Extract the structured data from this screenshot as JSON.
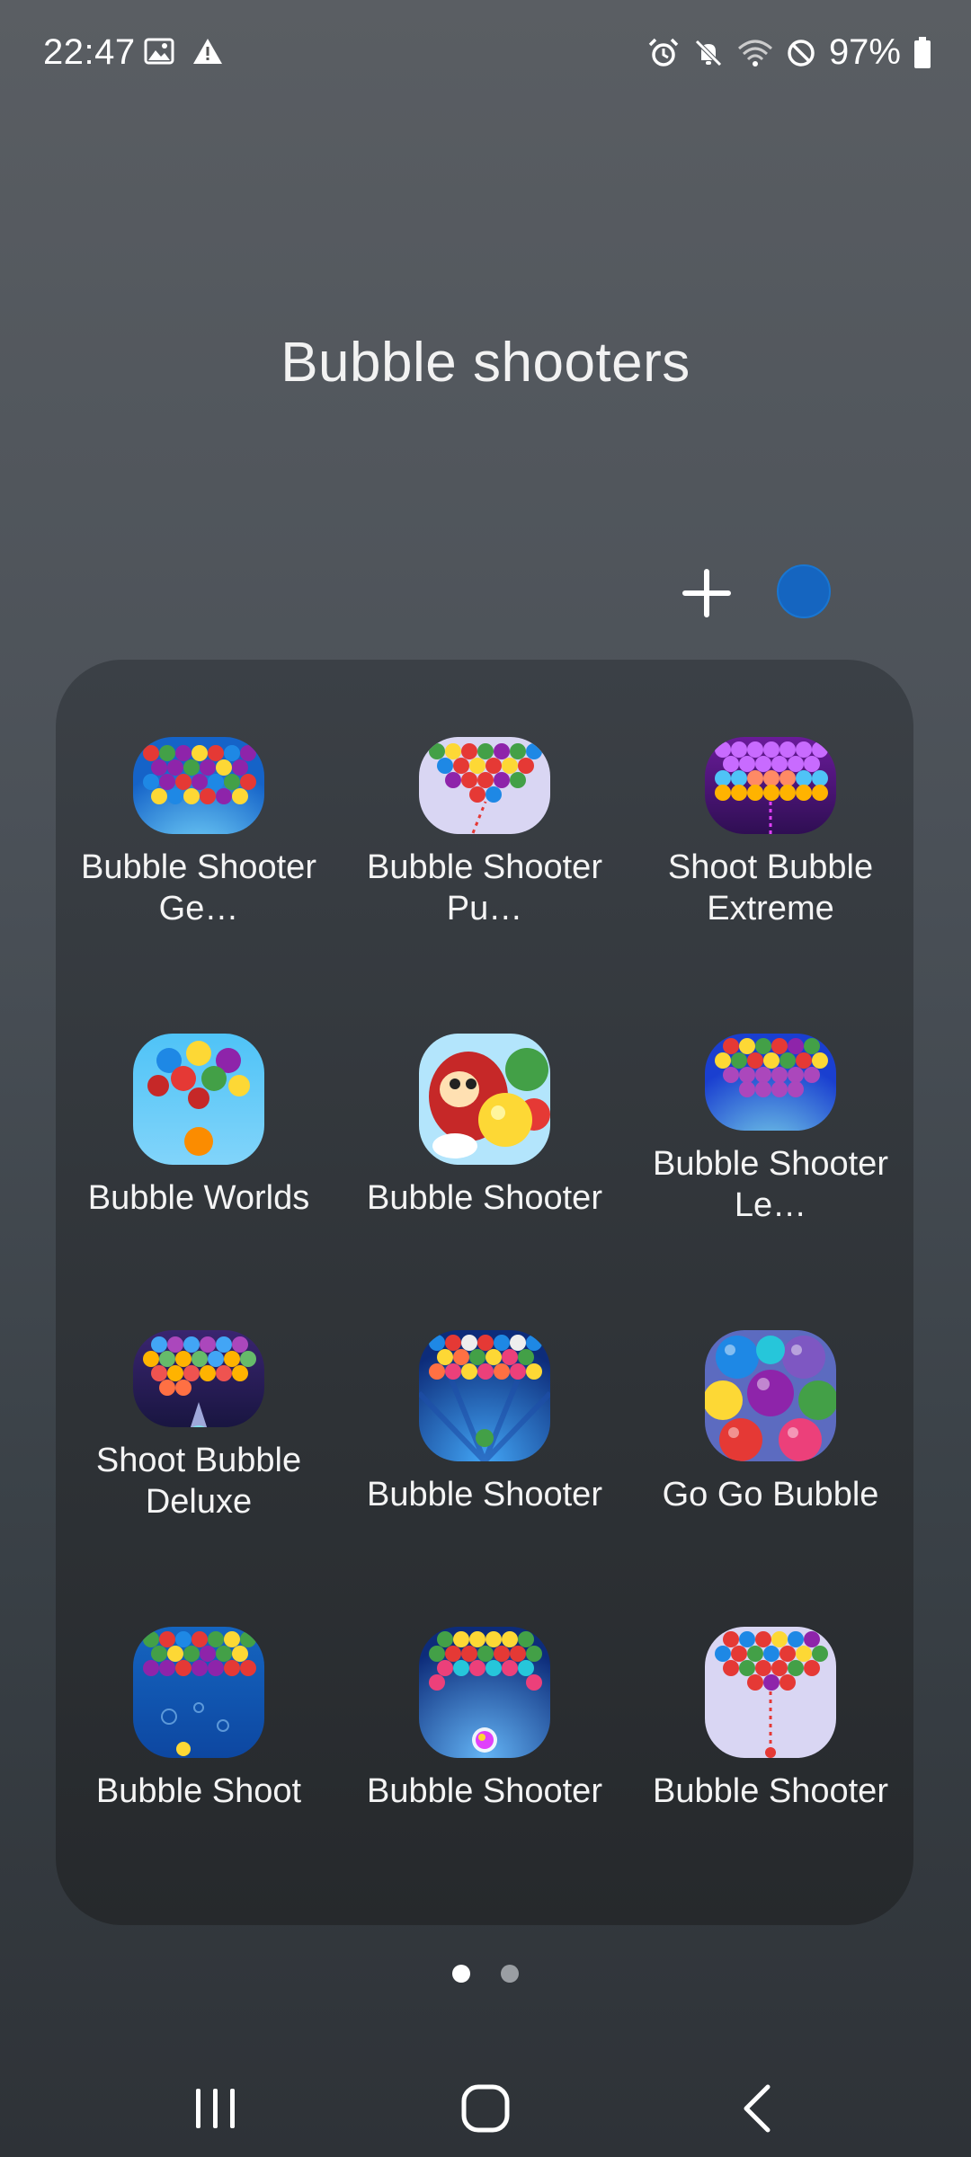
{
  "status_bar": {
    "time": "22:47",
    "battery": "97%",
    "left_icons": [
      "image-icon",
      "warning-icon"
    ],
    "right_icons": [
      "alarm-icon",
      "mute-icon",
      "wifi-icon",
      "dnd-icon",
      "battery-icon"
    ]
  },
  "folder": {
    "title": "Bubble shooters",
    "color": "#1565c0"
  },
  "apps": [
    {
      "label": "Bubble Shooter Ge…",
      "icon": "bubble-shooter-genies-icon"
    },
    {
      "label": "Bubble Shooter Pu…",
      "icon": "bubble-shooter-puzzle-icon"
    },
    {
      "label": "Shoot Bubble Extreme",
      "icon": "shoot-bubble-extreme-icon"
    },
    {
      "label": "Bubble Worlds",
      "icon": "bubble-worlds-icon"
    },
    {
      "label": "Bubble Shooter",
      "icon": "bubble-shooter-fox-icon"
    },
    {
      "label": "Bubble Shooter Le…",
      "icon": "bubble-shooter-legend-icon"
    },
    {
      "label": "Shoot Bubble Deluxe",
      "icon": "shoot-bubble-deluxe-icon"
    },
    {
      "label": "Bubble Shooter",
      "icon": "bubble-shooter-classic-icon"
    },
    {
      "label": "Go Go Bubble",
      "icon": "go-go-bubble-icon"
    },
    {
      "label": "Bubble Shoot",
      "icon": "bubble-shoot-icon"
    },
    {
      "label": "Bubble Shooter",
      "icon": "bubble-shooter-rainbow-icon"
    },
    {
      "label": "Bubble Shooter",
      "icon": "bubble-shooter-lavender-icon"
    }
  ],
  "pager": {
    "current_page": 1,
    "total_pages": 2
  },
  "nav": {
    "recents_icon": "recents-icon",
    "home_icon": "home-icon",
    "back_icon": "back-icon"
  }
}
